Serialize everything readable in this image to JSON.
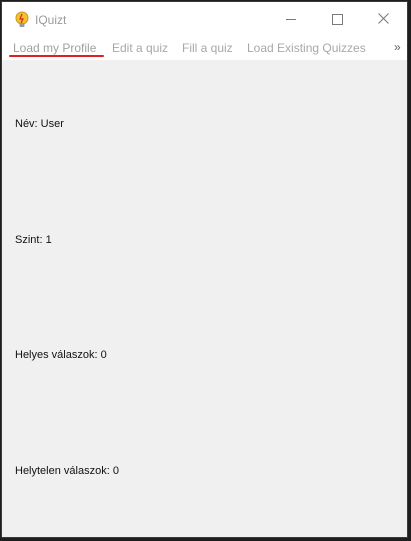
{
  "window": {
    "title": "IQuizt",
    "icon": "lightbulb-icon",
    "controls": {
      "minimize": "minimize-icon",
      "maximize": "maximize-icon",
      "close": "close-icon"
    }
  },
  "tabs": [
    {
      "label": "Load my Profile",
      "active": true
    },
    {
      "label": "Edit a quiz",
      "active": false
    },
    {
      "label": "Fill a quiz",
      "active": false
    },
    {
      "label": "Load Existing Quizzes",
      "active": false
    }
  ],
  "tab_overflow": "»",
  "profile": {
    "name": "Név: User",
    "level": "Szint: 1",
    "correct": "Helyes válaszok: 0",
    "incorrect": "Helytelen válaszok: 0"
  },
  "colors": {
    "active_tab_indicator": "#e31e1e",
    "content_background": "#f0f0f0",
    "titlebar_background": "#ffffff"
  }
}
